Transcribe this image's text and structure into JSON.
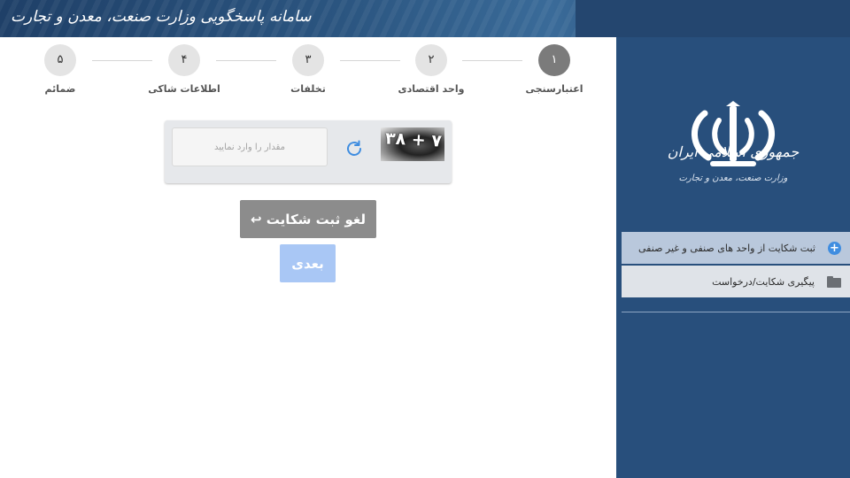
{
  "header": {
    "title": "سامانه پاسخگویی وزارت صنعت، معدن و تجارت"
  },
  "sidebar": {
    "emblem_title": "جمهوری اسلامی ایران",
    "emblem_subtitle": "وزارت صنعت، معدن و تجارت",
    "items": [
      {
        "label": "ثبت شکایت از واحد های صنفی و غیر صنفی",
        "icon": "plus-circle-icon",
        "active": true
      },
      {
        "label": "پیگیری شکایت/درخواست",
        "icon": "folder-icon",
        "active": false
      }
    ]
  },
  "stepper": {
    "steps": [
      {
        "number": "۱",
        "label": "اعتبارسنجی",
        "active": true
      },
      {
        "number": "۲",
        "label": "واحد اقتصادی",
        "active": false
      },
      {
        "number": "۳",
        "label": "تخلفات",
        "active": false
      },
      {
        "number": "۴",
        "label": "اطلاعات شاکی",
        "active": false
      },
      {
        "number": "۵",
        "label": "ضمائم",
        "active": false
      }
    ]
  },
  "captcha": {
    "placeholder": "مقدار را وارد نمایید",
    "value": "",
    "image_text": "۳۸ + ۷"
  },
  "buttons": {
    "cancel_label": "لغو ثبت شکایت",
    "next_label": "بعدی"
  },
  "colors": {
    "sidebar_bg": "#284f7c",
    "active_step": "#7b7b7b",
    "cancel_button": "#8c8c8c",
    "next_button": "#a9c7f5",
    "accent_blue": "#3f8de0"
  }
}
